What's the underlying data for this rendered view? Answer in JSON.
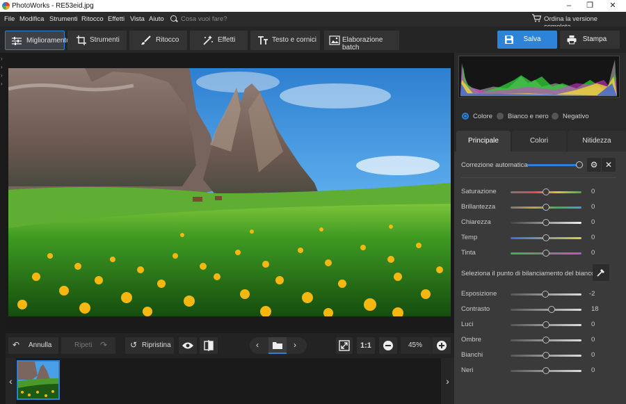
{
  "window": {
    "title": "PhotoWorks - RE53eid.jpg",
    "minimize": "–",
    "restore": "❐",
    "close": "✕"
  },
  "menu": {
    "items": [
      "File",
      "Modifica",
      "Strumenti",
      "Ritocco",
      "Effetti",
      "Vista",
      "Aiuto"
    ],
    "search_placeholder": "Cosa vuoi fare?",
    "order_label": "Ordina la versione completa"
  },
  "toolbar": {
    "tabs": [
      {
        "label": "Miglioramento",
        "icon": "sliders-icon"
      },
      {
        "label": "Strumenti",
        "icon": "crop-icon"
      },
      {
        "label": "Ritocco",
        "icon": "brush-icon"
      },
      {
        "label": "Effetti",
        "icon": "magic-wand-icon"
      },
      {
        "label": "Testo e cornici",
        "icon": "text-icon"
      },
      {
        "label": "Elaborazione batch",
        "icon": "batch-icon"
      }
    ],
    "save_label": "Salva",
    "print_label": "Stampa"
  },
  "bottombar": {
    "undo_label": "Annulla",
    "redo_label": "Ripeti",
    "reset_label": "Ripristina",
    "fit_label": "1:1",
    "zoom": "45%"
  },
  "panel": {
    "mode_options": [
      "Colore",
      "Bianco e nero",
      "Negativo"
    ],
    "mode_selected": "Colore",
    "tabs": [
      "Principale",
      "Colori",
      "Nitidezza"
    ],
    "auto_correction_label": "Correzione automatica",
    "white_balance_label": "Seleziona il punto di bilanciamento del bianco",
    "sliders_color": [
      {
        "label": "Saturazione",
        "value": "0"
      },
      {
        "label": "Brillantezza",
        "value": "0"
      },
      {
        "label": "Chiarezza",
        "value": "0"
      },
      {
        "label": "Temp",
        "value": "0"
      },
      {
        "label": "Tinta",
        "value": "0"
      }
    ],
    "sliders_tone": [
      {
        "label": "Esposizione",
        "value": "-2"
      },
      {
        "label": "Contrasto",
        "value": "18"
      },
      {
        "label": "Luci",
        "value": "0"
      },
      {
        "label": "Ombre",
        "value": "0"
      },
      {
        "label": "Bianchi",
        "value": "0"
      },
      {
        "label": "Neri",
        "value": "0"
      }
    ]
  },
  "colors": {
    "accent": "#2f7fd7"
  }
}
